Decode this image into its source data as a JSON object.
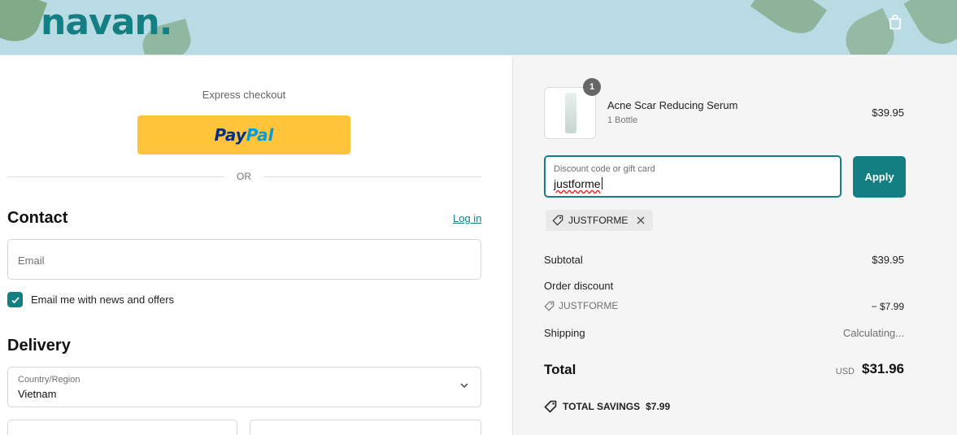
{
  "brand": {
    "logo_text": "navan.",
    "logo_color": "#137f83"
  },
  "header": {
    "cart_icon": "shopping-bag-icon"
  },
  "express": {
    "label": "Express checkout",
    "paypal_a": "Pay",
    "paypal_b": "Pal",
    "divider_text": "OR"
  },
  "contact": {
    "heading": "Contact",
    "login_link": "Log in",
    "email_placeholder": "Email",
    "newsletter_label": "Email me with news and offers",
    "newsletter_checked": true
  },
  "delivery": {
    "heading": "Delivery",
    "country_label": "Country/Region",
    "country_value": "Vietnam"
  },
  "cart": {
    "item": {
      "quantity": "1",
      "name": "Acne Scar Reducing Serum",
      "variant": "1 Bottle",
      "price": "$39.95"
    }
  },
  "discount": {
    "label": "Discount code or gift card",
    "value": "justforme",
    "apply_label": "Apply",
    "applied_code": "JUSTFORME"
  },
  "summary": {
    "subtotal_label": "Subtotal",
    "subtotal_value": "$39.95",
    "order_discount_label": "Order discount",
    "discount_code": "JUSTFORME",
    "discount_value": "− $7.99",
    "shipping_label": "Shipping",
    "shipping_value": "Calculating...",
    "total_label": "Total",
    "currency": "USD",
    "total_value": "$31.96",
    "savings_label": "TOTAL SAVINGS",
    "savings_value": "$7.99"
  },
  "colors": {
    "accent": "#137f83",
    "paypal_yellow": "#ffc439",
    "header_bg": "#b9dbe3"
  }
}
